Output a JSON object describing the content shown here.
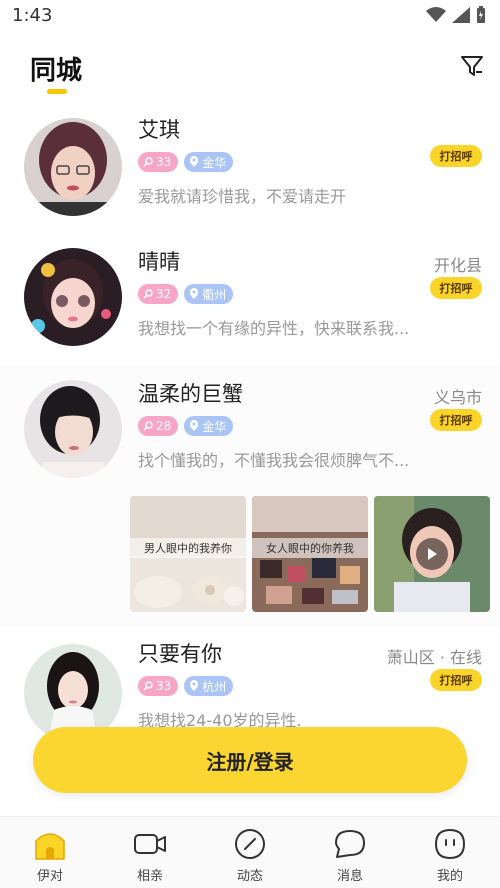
{
  "status_bar": {
    "time": "1:43"
  },
  "header": {
    "title": "同城",
    "accent_color": "#f7c600"
  },
  "users": [
    {
      "name": "艾琪",
      "location": "",
      "age": "33",
      "city": "金华",
      "bio": "爱我就请珍惜我，不爱请走开",
      "greet_label": "打招呼"
    },
    {
      "name": "晴晴",
      "location": "开化县",
      "age": "32",
      "city": "衢州",
      "bio": "我想找一个有缘的异性，快来联系我...",
      "greet_label": "打招呼"
    },
    {
      "name": "温柔的巨蟹",
      "location": "义乌市",
      "age": "28",
      "city": "金华",
      "bio": "找个懂我的，不懂我我会很烦脾气不...",
      "greet_label": "打招呼",
      "photos": [
        {
          "caption": "男人眼中的我养你"
        },
        {
          "caption": "女人眼中的你养我"
        },
        {
          "caption": ""
        }
      ]
    },
    {
      "name": "只要有你",
      "location": "萧山区 · 在线",
      "age": "33",
      "city": "杭州",
      "bio": "我想找24-40岁的异性.",
      "greet_label": "打招呼"
    }
  ],
  "login_button": {
    "label": "注册/登录"
  },
  "tabs": [
    {
      "label": "伊对",
      "icon": "home-icon",
      "active": true
    },
    {
      "label": "相亲",
      "icon": "video-icon"
    },
    {
      "label": "动态",
      "icon": "compass-icon"
    },
    {
      "label": "消息",
      "icon": "message-icon"
    },
    {
      "label": "我的",
      "icon": "profile-icon"
    }
  ]
}
